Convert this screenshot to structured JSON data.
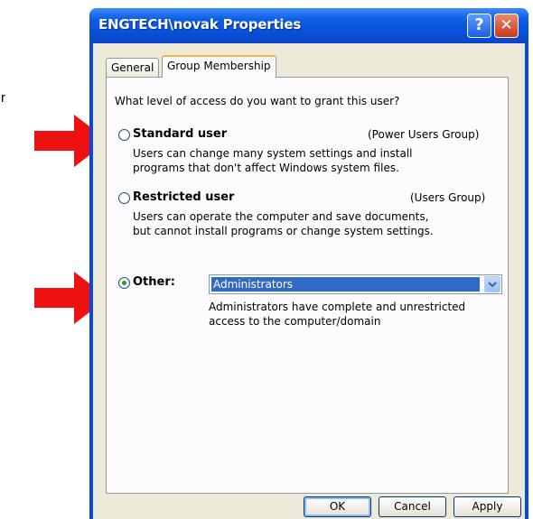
{
  "page": {
    "stray_text": "r"
  },
  "window": {
    "title": "ENGTECH\\novak Properties",
    "help_glyph": "?",
    "close_glyph": "✕"
  },
  "tabs": [
    {
      "label": "General",
      "active": false
    },
    {
      "label": "Group Membership",
      "active": true
    }
  ],
  "group_membership": {
    "question": "What level of access do you want to grant this user?",
    "options": [
      {
        "label": "Standard user",
        "group": "(Power Users Group)",
        "description_lines": [
          "Users can change many system settings and install",
          "programs that don't affect Windows system files."
        ],
        "selected": false
      },
      {
        "label": "Restricted user",
        "group": "(Users Group)",
        "description_lines": [
          "Users can operate the computer and save documents,",
          "but cannot install programs or change system settings."
        ],
        "selected": false
      },
      {
        "label": "Other:",
        "selected": true,
        "dropdown_value": "Administrators",
        "description_lines": [
          "Administrators have complete and unrestricted",
          "access to the computer/domain"
        ]
      }
    ]
  },
  "buttons": {
    "ok": "OK",
    "cancel": "Cancel",
    "apply": "Apply"
  },
  "colors": {
    "title_bar": "#0a49d8",
    "dialog_bg": "#ece9d8",
    "arrow": "#ee1111",
    "selected_highlight": "#316ac5",
    "radio_dot": "#21a121"
  }
}
